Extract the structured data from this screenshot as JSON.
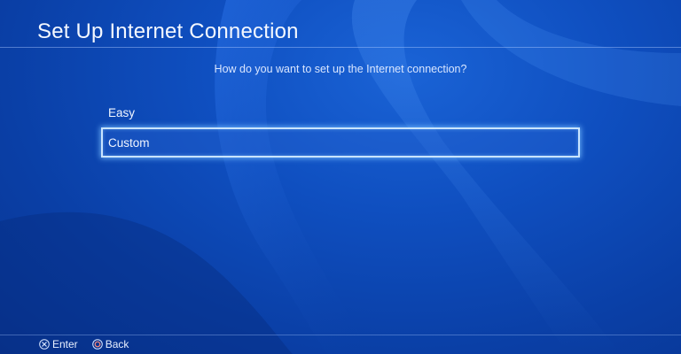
{
  "header": {
    "title": "Set Up Internet Connection"
  },
  "main": {
    "question": "How do you want to set up the Internet connection?",
    "options": [
      {
        "label": "Easy",
        "selected": false
      },
      {
        "label": "Custom",
        "selected": true
      }
    ]
  },
  "footer": {
    "hints": [
      {
        "icon": "cross-button-icon",
        "label": "Enter"
      },
      {
        "icon": "circle-button-icon",
        "label": "Back"
      }
    ]
  },
  "colors": {
    "background": "#0f4fc0",
    "selection_border": "#c9e4ff",
    "text": "#ffffff"
  }
}
